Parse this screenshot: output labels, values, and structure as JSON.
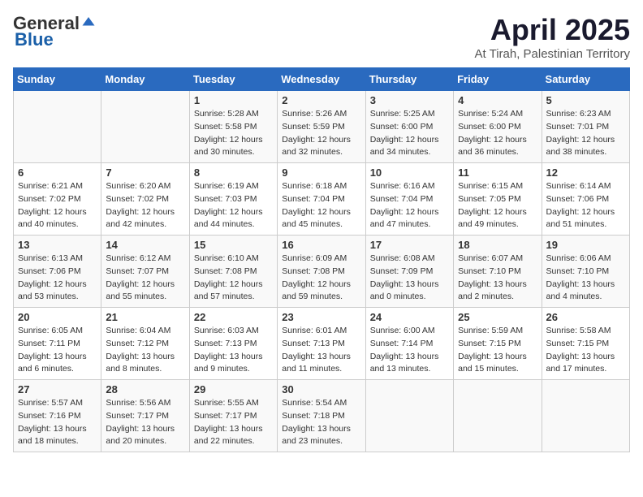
{
  "header": {
    "logo_general": "General",
    "logo_blue": "Blue",
    "title": "April 2025",
    "subtitle": "At Tirah, Palestinian Territory"
  },
  "days_of_week": [
    "Sunday",
    "Monday",
    "Tuesday",
    "Wednesday",
    "Thursday",
    "Friday",
    "Saturday"
  ],
  "weeks": [
    [
      {
        "day": "",
        "sunrise": "",
        "sunset": "",
        "daylight": ""
      },
      {
        "day": "",
        "sunrise": "",
        "sunset": "",
        "daylight": ""
      },
      {
        "day": "1",
        "sunrise": "Sunrise: 5:28 AM",
        "sunset": "Sunset: 5:58 PM",
        "daylight": "Daylight: 12 hours and 30 minutes."
      },
      {
        "day": "2",
        "sunrise": "Sunrise: 5:26 AM",
        "sunset": "Sunset: 5:59 PM",
        "daylight": "Daylight: 12 hours and 32 minutes."
      },
      {
        "day": "3",
        "sunrise": "Sunrise: 5:25 AM",
        "sunset": "Sunset: 6:00 PM",
        "daylight": "Daylight: 12 hours and 34 minutes."
      },
      {
        "day": "4",
        "sunrise": "Sunrise: 5:24 AM",
        "sunset": "Sunset: 6:00 PM",
        "daylight": "Daylight: 12 hours and 36 minutes."
      },
      {
        "day": "5",
        "sunrise": "Sunrise: 6:23 AM",
        "sunset": "Sunset: 7:01 PM",
        "daylight": "Daylight: 12 hours and 38 minutes."
      }
    ],
    [
      {
        "day": "6",
        "sunrise": "Sunrise: 6:21 AM",
        "sunset": "Sunset: 7:02 PM",
        "daylight": "Daylight: 12 hours and 40 minutes."
      },
      {
        "day": "7",
        "sunrise": "Sunrise: 6:20 AM",
        "sunset": "Sunset: 7:02 PM",
        "daylight": "Daylight: 12 hours and 42 minutes."
      },
      {
        "day": "8",
        "sunrise": "Sunrise: 6:19 AM",
        "sunset": "Sunset: 7:03 PM",
        "daylight": "Daylight: 12 hours and 44 minutes."
      },
      {
        "day": "9",
        "sunrise": "Sunrise: 6:18 AM",
        "sunset": "Sunset: 7:04 PM",
        "daylight": "Daylight: 12 hours and 45 minutes."
      },
      {
        "day": "10",
        "sunrise": "Sunrise: 6:16 AM",
        "sunset": "Sunset: 7:04 PM",
        "daylight": "Daylight: 12 hours and 47 minutes."
      },
      {
        "day": "11",
        "sunrise": "Sunrise: 6:15 AM",
        "sunset": "Sunset: 7:05 PM",
        "daylight": "Daylight: 12 hours and 49 minutes."
      },
      {
        "day": "12",
        "sunrise": "Sunrise: 6:14 AM",
        "sunset": "Sunset: 7:06 PM",
        "daylight": "Daylight: 12 hours and 51 minutes."
      }
    ],
    [
      {
        "day": "13",
        "sunrise": "Sunrise: 6:13 AM",
        "sunset": "Sunset: 7:06 PM",
        "daylight": "Daylight: 12 hours and 53 minutes."
      },
      {
        "day": "14",
        "sunrise": "Sunrise: 6:12 AM",
        "sunset": "Sunset: 7:07 PM",
        "daylight": "Daylight: 12 hours and 55 minutes."
      },
      {
        "day": "15",
        "sunrise": "Sunrise: 6:10 AM",
        "sunset": "Sunset: 7:08 PM",
        "daylight": "Daylight: 12 hours and 57 minutes."
      },
      {
        "day": "16",
        "sunrise": "Sunrise: 6:09 AM",
        "sunset": "Sunset: 7:08 PM",
        "daylight": "Daylight: 12 hours and 59 minutes."
      },
      {
        "day": "17",
        "sunrise": "Sunrise: 6:08 AM",
        "sunset": "Sunset: 7:09 PM",
        "daylight": "Daylight: 13 hours and 0 minutes."
      },
      {
        "day": "18",
        "sunrise": "Sunrise: 6:07 AM",
        "sunset": "Sunset: 7:10 PM",
        "daylight": "Daylight: 13 hours and 2 minutes."
      },
      {
        "day": "19",
        "sunrise": "Sunrise: 6:06 AM",
        "sunset": "Sunset: 7:10 PM",
        "daylight": "Daylight: 13 hours and 4 minutes."
      }
    ],
    [
      {
        "day": "20",
        "sunrise": "Sunrise: 6:05 AM",
        "sunset": "Sunset: 7:11 PM",
        "daylight": "Daylight: 13 hours and 6 minutes."
      },
      {
        "day": "21",
        "sunrise": "Sunrise: 6:04 AM",
        "sunset": "Sunset: 7:12 PM",
        "daylight": "Daylight: 13 hours and 8 minutes."
      },
      {
        "day": "22",
        "sunrise": "Sunrise: 6:03 AM",
        "sunset": "Sunset: 7:13 PM",
        "daylight": "Daylight: 13 hours and 9 minutes."
      },
      {
        "day": "23",
        "sunrise": "Sunrise: 6:01 AM",
        "sunset": "Sunset: 7:13 PM",
        "daylight": "Daylight: 13 hours and 11 minutes."
      },
      {
        "day": "24",
        "sunrise": "Sunrise: 6:00 AM",
        "sunset": "Sunset: 7:14 PM",
        "daylight": "Daylight: 13 hours and 13 minutes."
      },
      {
        "day": "25",
        "sunrise": "Sunrise: 5:59 AM",
        "sunset": "Sunset: 7:15 PM",
        "daylight": "Daylight: 13 hours and 15 minutes."
      },
      {
        "day": "26",
        "sunrise": "Sunrise: 5:58 AM",
        "sunset": "Sunset: 7:15 PM",
        "daylight": "Daylight: 13 hours and 17 minutes."
      }
    ],
    [
      {
        "day": "27",
        "sunrise": "Sunrise: 5:57 AM",
        "sunset": "Sunset: 7:16 PM",
        "daylight": "Daylight: 13 hours and 18 minutes."
      },
      {
        "day": "28",
        "sunrise": "Sunrise: 5:56 AM",
        "sunset": "Sunset: 7:17 PM",
        "daylight": "Daylight: 13 hours and 20 minutes."
      },
      {
        "day": "29",
        "sunrise": "Sunrise: 5:55 AM",
        "sunset": "Sunset: 7:17 PM",
        "daylight": "Daylight: 13 hours and 22 minutes."
      },
      {
        "day": "30",
        "sunrise": "Sunrise: 5:54 AM",
        "sunset": "Sunset: 7:18 PM",
        "daylight": "Daylight: 13 hours and 23 minutes."
      },
      {
        "day": "",
        "sunrise": "",
        "sunset": "",
        "daylight": ""
      },
      {
        "day": "",
        "sunrise": "",
        "sunset": "",
        "daylight": ""
      },
      {
        "day": "",
        "sunrise": "",
        "sunset": "",
        "daylight": ""
      }
    ]
  ]
}
